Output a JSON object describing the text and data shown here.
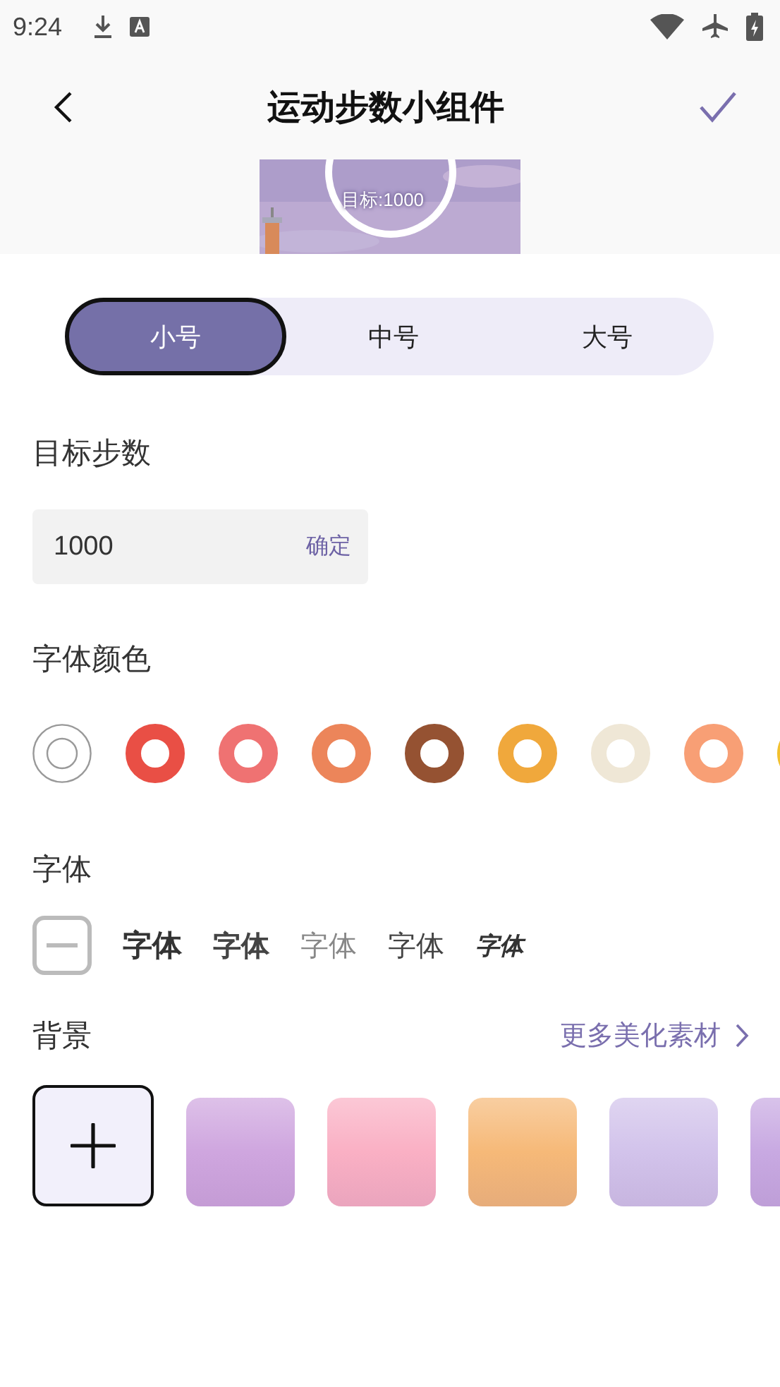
{
  "status_bar": {
    "time": "9:24"
  },
  "header": {
    "title": "运动步数小组件"
  },
  "preview": {
    "kind": "picture",
    "goal_text": "目标:1000"
  },
  "size_tabs": [
    {
      "label": "小号",
      "selected": true
    },
    {
      "label": "中号",
      "selected": false
    },
    {
      "label": "大号",
      "selected": false
    }
  ],
  "goal": {
    "title": "目标步数",
    "value": "1000",
    "confirm": "确定"
  },
  "font_color": {
    "title": "字体颜色",
    "swatches": [
      {
        "kind": "default"
      },
      {
        "kind": "swatch",
        "color": "#e94f45"
      },
      {
        "kind": "swatch",
        "color": "#ef7272"
      },
      {
        "kind": "swatch",
        "color": "#ec855a"
      },
      {
        "kind": "swatch",
        "color": "#955232"
      },
      {
        "kind": "swatch",
        "color": "#f0a83c"
      },
      {
        "kind": "swatch",
        "color": "#efe7d6"
      },
      {
        "kind": "swatch",
        "color": "#f89f75"
      },
      {
        "kind": "swatch",
        "color": "#f2c12e"
      }
    ]
  },
  "font": {
    "title": "字体",
    "options": [
      {
        "kind": "none"
      },
      {
        "kind": "heavy",
        "label": "字体"
      },
      {
        "kind": "bold",
        "label": "字体"
      },
      {
        "kind": "light",
        "label": "字体"
      },
      {
        "kind": "regular",
        "label": "字体"
      },
      {
        "kind": "italic",
        "label": "字体"
      }
    ]
  },
  "background": {
    "title": "背景",
    "more_link": "更多美化素材",
    "tiles": [
      {
        "kind": "add",
        "selected": true
      },
      {
        "kind": "gradient",
        "selected": false,
        "color": "#cfa6df"
      },
      {
        "kind": "gradient",
        "selected": false,
        "color": "#fab0c4"
      },
      {
        "kind": "gradient",
        "selected": false,
        "color": "#f6b978"
      },
      {
        "kind": "gradient",
        "selected": false,
        "color": "#d2c3eb"
      },
      {
        "kind": "gradient",
        "selected": false,
        "color": "#c8a9e2"
      }
    ]
  }
}
